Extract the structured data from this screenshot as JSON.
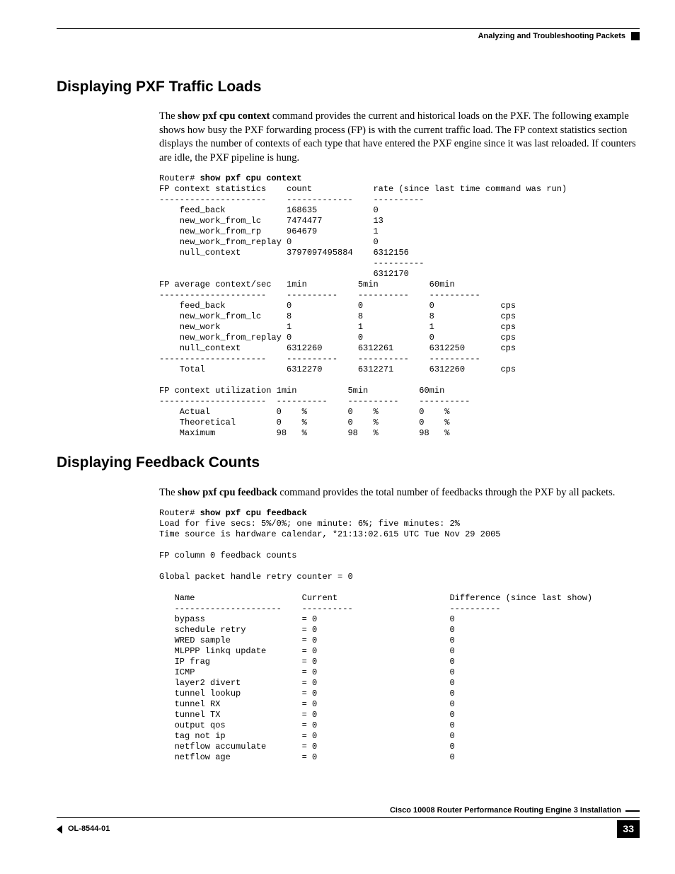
{
  "header": {
    "chapter_title": "Analyzing and Troubleshooting Packets"
  },
  "section1": {
    "heading": "Displaying PXF Traffic Loads",
    "paragraph": "The show pxf cpu context command provides the current and historical loads on the PXF. The following example shows how busy the PXF forwarding process (FP) is with the current traffic load. The FP context statistics section displays the number of contexts of each type that have entered the PXF engine since it was last reloaded. If counters are idle, the PXF pipeline is hung.",
    "bold_cmd": "show pxf cpu context",
    "cli_prefix": "Router# ",
    "cli_command": "show pxf cpu context",
    "cli_body": "FP context statistics    count            rate (since last time command was run)\n---------------------    -------------    ----------\n    feed_back            168635           0\n    new_work_from_lc     7474477          13\n    new_work_from_rp     964679           1\n    new_work_from_replay 0                0\n    null_context         3797097495884    6312156\n                                          ----------\n                                          6312170\nFP average context/sec   1min          5min          60min\n---------------------    ----------    ----------    ----------\n    feed_back            0             0             0             cps\n    new_work_from_lc     8             8             8             cps\n    new_work             1             1             1             cps\n    new_work_from_replay 0             0             0             cps\n    null_context         6312260       6312261       6312250       cps\n---------------------    ----------    ----------    ----------\n    Total                6312270       6312271       6312260       cps\n\nFP context utilization 1min          5min          60min\n---------------------  ----------    ----------    ----------\n    Actual             0    %        0    %        0    %\n    Theoretical        0    %        0    %        0    %\n    Maximum            98   %        98   %        98   %"
  },
  "section2": {
    "heading": "Displaying Feedback Counts",
    "paragraph": "The show pxf cpu feedback command provides the total number of feedbacks through the PXF by all packets.",
    "bold_cmd": "show pxf cpu feedback",
    "cli_prefix": "Router# ",
    "cli_command": "show pxf cpu feedback",
    "cli_body": "Load for five secs: 5%/0%; one minute: 6%; five minutes: 2%\nTime source is hardware calendar, *21:13:02.615 UTC Tue Nov 29 2005\n\nFP column 0 feedback counts\n\nGlobal packet handle retry counter = 0\n\n   Name                     Current                      Difference (since last show)\n   ---------------------    ----------                   ----------\n   bypass                   = 0                          0\n   schedule retry           = 0                          0\n   WRED sample              = 0                          0\n   MLPPP linkq update       = 0                          0\n   IP frag                  = 0                          0\n   ICMP                     = 0                          0\n   layer2 divert            = 0                          0\n   tunnel lookup            = 0                          0\n   tunnel RX                = 0                          0\n   tunnel TX                = 0                          0\n   output qos               = 0                          0\n   tag not ip               = 0                          0\n   netflow accumulate       = 0                          0\n   netflow age              = 0                          0"
  },
  "footer": {
    "doc_title": "Cisco 10008 Router Performance Routing Engine 3 Installation",
    "doc_id": "OL-8544-01",
    "page_number": "33"
  }
}
